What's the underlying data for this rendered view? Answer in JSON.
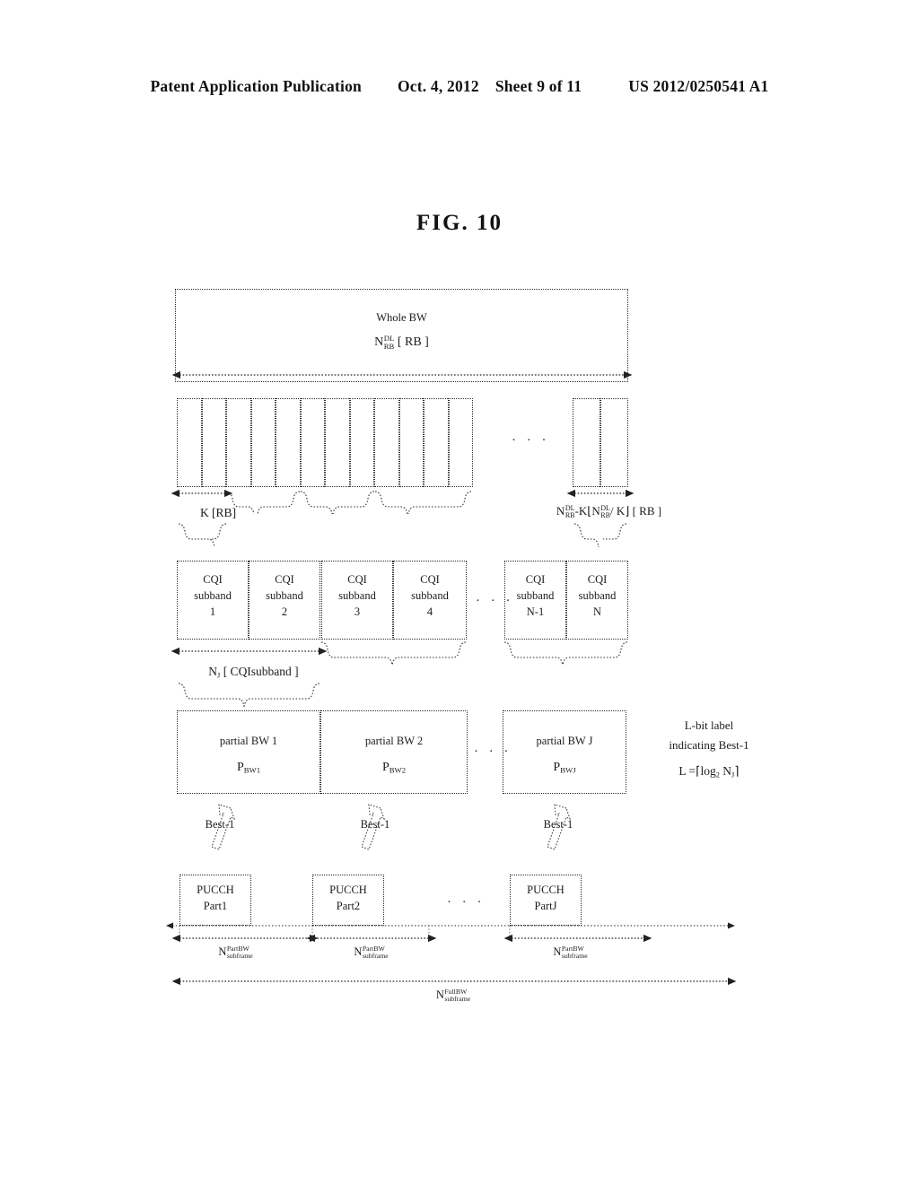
{
  "header": {
    "publication": "Patent Application Publication",
    "date": "Oct. 4, 2012",
    "sheet": "Sheet 9 of 11",
    "patent_number": "US 2012/0250541 A1"
  },
  "figure": {
    "title": "FIG. 10"
  },
  "whole_bw": {
    "label": "Whole BW",
    "formula_N": "N",
    "formula_sup": "DL",
    "formula_sub": "RB",
    "formula_unit": "[ RB ]"
  },
  "rb_grid": {
    "left_cells": 12,
    "right_cells": 2,
    "ellipsis": "· · ·",
    "left_label": "K [RB]",
    "right_formula": {
      "n1": "N",
      "sup1": "DL",
      "sub1": "RB",
      "mid": "-K",
      "floor_open": "⌊",
      "n2": "N",
      "sup2": "DL",
      "sub2": "RB",
      "div": "/ K",
      "floor_close": "⌋",
      "unit": "[ RB ]"
    }
  },
  "cqi_subbands": {
    "ellipsis": "· · ·",
    "items": [
      {
        "line1": "CQI",
        "line2": "subband",
        "line3": "1"
      },
      {
        "line1": "CQI",
        "line2": "subband",
        "line3": "2"
      },
      {
        "line1": "CQI",
        "line2": "subband",
        "line3": "3"
      },
      {
        "line1": "CQI",
        "line2": "subband",
        "line3": "4"
      },
      {
        "line1": "CQI",
        "line2": "subband",
        "line3": "N-1"
      },
      {
        "line1": "CQI",
        "line2": "subband",
        "line3": "N"
      }
    ],
    "brace_label": {
      "n": "N",
      "sub": "J",
      "unit": "[ CQIsubband ]"
    }
  },
  "partial_bw": {
    "ellipsis": "· · ·",
    "items": [
      {
        "title": "partial BW 1",
        "sym_p": "P",
        "sym_sub": "BW1"
      },
      {
        "title": "partial BW 2",
        "sym_p": "P",
        "sym_sub": "BW2"
      },
      {
        "title": "partial BW J",
        "sym_p": "P",
        "sym_sub": "BWJ"
      }
    ],
    "note": {
      "line1": "L-bit label",
      "line2": "indicating Best-1",
      "line3_L": "L",
      "line3_eq": "=",
      "line3_open": "⌈",
      "line3_log": "log",
      "line3_logsub": "2",
      "line3_N": "N",
      "line3_Nsub": "J",
      "line3_close": "⌉"
    }
  },
  "best_arrows": {
    "label": "Best-1",
    "count": 3
  },
  "pucch": {
    "ellipsis": "· · ·",
    "items": [
      {
        "line1": "PUCCH",
        "line2": "Part1"
      },
      {
        "line1": "PUCCH",
        "line2": "Part2"
      },
      {
        "line1": "PUCCH",
        "line2": "PartJ"
      }
    ]
  },
  "subframe_labels": {
    "part_bw": {
      "n": "N",
      "sup": "PartBW",
      "sub": "subframe"
    },
    "full_bw": {
      "n": "N",
      "sup": "FullBW",
      "sub": "subframe"
    }
  }
}
